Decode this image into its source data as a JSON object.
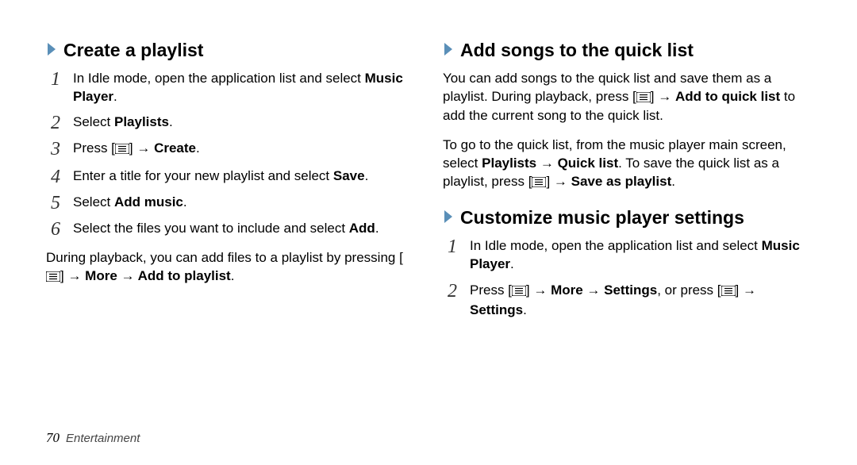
{
  "left": {
    "heading": "Create a playlist",
    "steps": [
      {
        "pre": "In Idle mode, open the application list and select ",
        "bold": "Music Player",
        "post": "."
      },
      {
        "pre": "Select ",
        "bold": "Playlists",
        "post": "."
      },
      {
        "pre": "Press [",
        "icon": true,
        "mid": "] → ",
        "bold": "Create",
        "post": "."
      },
      {
        "pre": "Enter a title for your new playlist and select ",
        "bold": "Save",
        "post": "."
      },
      {
        "pre": "Select ",
        "bold": "Add music",
        "post": "."
      },
      {
        "pre": "Select the files you want to include and select ",
        "bold": "Add",
        "post": "."
      }
    ],
    "after_pre": "During playback, you can add files to a playlist by pressing [",
    "after_icon": true,
    "after_mid": "] → ",
    "after_bold": "More → Add to playlist",
    "after_post": "."
  },
  "right": {
    "heading1": "Add songs to the quick list",
    "p1_pre": "You can add songs to the quick list and save them as a playlist. During playback, press [",
    "p1_mid": "] → ",
    "p1_bold": "Add to quick list",
    "p1_post": " to add the current song to the quick list.",
    "p2_pre": "To go to the quick list, from the music player main screen, select ",
    "p2_bold1": "Playlists → Quick list",
    "p2_mid": ". To save the quick list as a playlist, press [",
    "p2_mid2": "] → ",
    "p2_bold2": "Save as playlist",
    "p2_post": ".",
    "heading2": "Customize music player settings",
    "steps2": [
      {
        "pre": "In Idle mode, open the application list and select ",
        "bold": "Music Player",
        "post": "."
      },
      {
        "pre": "Press [",
        "icon": true,
        "mid": "] → ",
        "bold": "More → Settings",
        "post_pre": ", or press [",
        "icon2": true,
        "post_mid": "] → ",
        "bold2": "Settings",
        "post": "."
      }
    ]
  },
  "footer": {
    "page": "70",
    "section": "Entertainment"
  }
}
